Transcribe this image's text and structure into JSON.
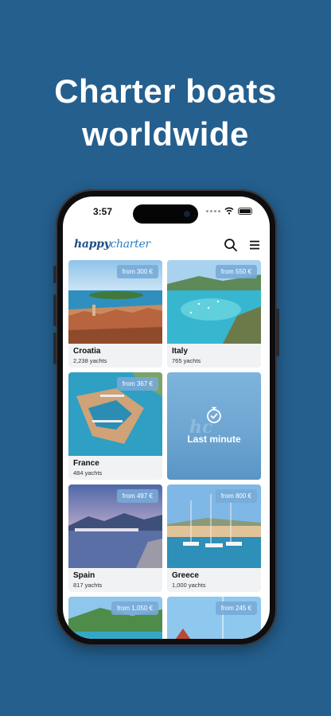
{
  "headline": {
    "line1": "Charter boats",
    "line2": "worldwide"
  },
  "status_bar": {
    "time": "3:57"
  },
  "app": {
    "logo_part1": "happy",
    "logo_part2": "charter",
    "search_icon": "search-icon",
    "menu_icon": "hamburger-menu-icon"
  },
  "destinations": [
    {
      "name": "Croatia",
      "count": "2,238 yachts",
      "price": "from 300 €"
    },
    {
      "name": "Italy",
      "count": "765 yachts",
      "price": "from 550 €"
    },
    {
      "name": "France",
      "count": "484 yachts",
      "price": "from 367 €"
    },
    {
      "name": "Spain",
      "count": "817 yachts",
      "price": "from 497 €"
    },
    {
      "name": "Greece",
      "count": "1,000 yachts",
      "price": "from 800 €"
    },
    {
      "price": "from 1,050 €"
    },
    {
      "price": "from 245 €"
    }
  ],
  "last_minute": {
    "label": "Last minute",
    "icon": "stopwatch-icon"
  },
  "colors": {
    "background": "#245f8e",
    "price_badge": "#78aad7",
    "logo": "#1c4f86"
  }
}
